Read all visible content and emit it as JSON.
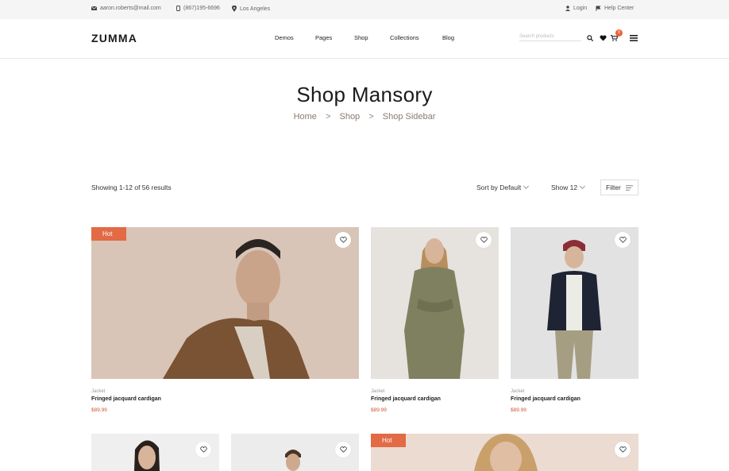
{
  "topbar": {
    "email": "aaron.roberts@mail.com",
    "phone": "(867)195-6696",
    "location": "Los Angeles",
    "login": "Login",
    "help": "Help Center"
  },
  "header": {
    "logo": "ZUMMA",
    "nav": [
      "Demos",
      "Pages",
      "Shop",
      "Collections",
      "Blog"
    ],
    "search_placeholder": "Search products",
    "cart_count": "0"
  },
  "page": {
    "title": "Shop Mansory",
    "breadcrumb": [
      "Home",
      "Shop",
      "Shop Sidebar"
    ],
    "breadcrumb_sep": ">"
  },
  "toolbar": {
    "results": "Showing 1-12 of 56 results",
    "sort": "Sort by Default",
    "show": "Show 12",
    "filter": "Filter"
  },
  "products": [
    {
      "badge": "Hot",
      "category": "Jacket",
      "name": "Fringed jacquard cardigan",
      "price": "$89.99"
    },
    {
      "badge": "",
      "category": "Jacket",
      "name": "Fringed jacquard cardigan",
      "price": "$89.99"
    },
    {
      "badge": "",
      "category": "Jacket",
      "name": "Fringed jacquard cardigan",
      "price": "$89.99"
    },
    {
      "badge": "",
      "category": "",
      "name": "",
      "price": ""
    },
    {
      "badge": "",
      "category": "",
      "name": "",
      "price": ""
    },
    {
      "badge": "Hot",
      "category": "",
      "name": "",
      "price": ""
    }
  ],
  "colors": {
    "accent": "#e26a45",
    "price": "#d0562f",
    "topbar_bg": "#f5f5f5"
  }
}
